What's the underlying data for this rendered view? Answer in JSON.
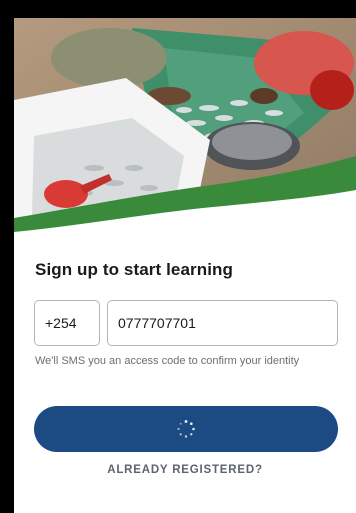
{
  "signup": {
    "title": "Sign up to start learning",
    "country_code": "+254",
    "phone_number": "0777707701",
    "hint": "We'll SMS you an access code to confirm your identity"
  },
  "actions": {
    "submit_state": "loading",
    "already_registered_label": "ALREADY REGISTERED?"
  },
  "colors": {
    "primary": "#1c4a83",
    "wave_green": "#3a8a3c",
    "hint_text": "#6e6e6e"
  },
  "icons": {
    "submit_loading": "spinner-icon"
  }
}
